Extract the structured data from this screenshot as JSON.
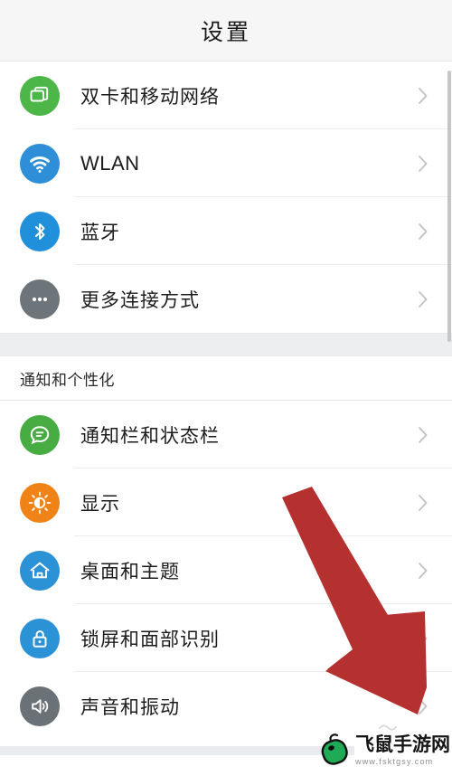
{
  "header": {
    "title": "设置"
  },
  "groups": [
    {
      "header": null,
      "rows": [
        {
          "label": "双卡和移动网络",
          "icon": "sim-card-icon",
          "icon_color": "#4cb648",
          "name": "sim-and-mobile-network"
        },
        {
          "label": "WLAN",
          "icon": "wifi-icon",
          "icon_color": "#2e8fd8",
          "name": "wlan"
        },
        {
          "label": "蓝牙",
          "icon": "bluetooth-icon",
          "icon_color": "#2090da",
          "name": "bluetooth"
        },
        {
          "label": "更多连接方式",
          "icon": "more-dots-icon",
          "icon_color": "#6e757a",
          "name": "more-connections"
        }
      ]
    },
    {
      "header": "通知和个性化",
      "rows": [
        {
          "label": "通知栏和状态栏",
          "icon": "chat-bubble-icon",
          "icon_color": "#47ad42",
          "name": "notification-and-status-bar"
        },
        {
          "label": "显示",
          "icon": "brightness-icon",
          "icon_color": "#f08318",
          "name": "display"
        },
        {
          "label": "桌面和主题",
          "icon": "home-icon",
          "icon_color": "#2b92d6",
          "name": "home-screen-and-theme"
        },
        {
          "label": "锁屏和面部识别",
          "icon": "lock-icon",
          "icon_color": "#2b92d6",
          "name": "lock-screen-and-face-unlock"
        },
        {
          "label": "声音和振动",
          "icon": "speaker-icon",
          "icon_color": "#6b7277",
          "name": "sound-and-vibration"
        }
      ]
    }
  ],
  "chevron": "chevron-right-icon",
  "annotation": {
    "arrow_color": "#b5312f",
    "direction": "down-right"
  },
  "watermark": {
    "title": "飞鼠手游网",
    "url": "www.fsktgsy.com",
    "logo_color": "#1faa55"
  }
}
